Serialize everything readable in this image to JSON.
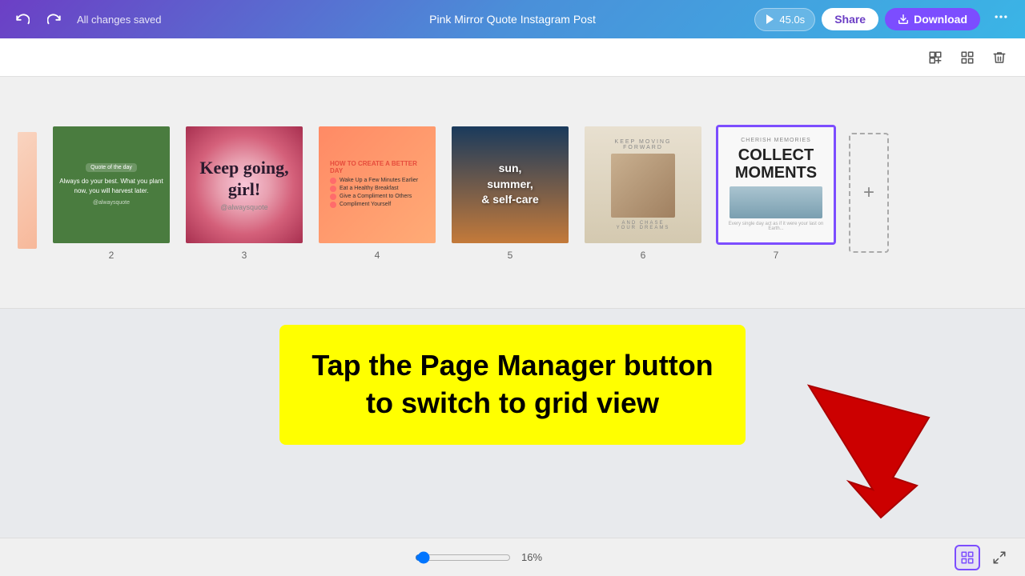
{
  "topbar": {
    "undo_label": "↩",
    "redo_label": "↪",
    "status": "All changes saved",
    "title": "Pink Mirror Quote Instagram Post",
    "share_label": "Share",
    "present_label": "45.0s",
    "download_label": "Download",
    "more_label": "⋯"
  },
  "toolbar2": {
    "add_page_icon": "+⊞",
    "grid_icon": "⊞",
    "trash_icon": "🗑"
  },
  "pages": [
    {
      "num": "",
      "active": false
    },
    {
      "num": "2",
      "active": false
    },
    {
      "num": "3",
      "active": false
    },
    {
      "num": "4",
      "active": false
    },
    {
      "num": "5",
      "active": false
    },
    {
      "num": "6",
      "active": false
    },
    {
      "num": "7",
      "active": true
    }
  ],
  "tooltip": {
    "line1": "Tap the Page Manager button",
    "line2": "to switch to grid view"
  },
  "bottombar": {
    "zoom_pct": "16%",
    "page_manager_icon": "⊞",
    "expand_icon": "⤢"
  }
}
